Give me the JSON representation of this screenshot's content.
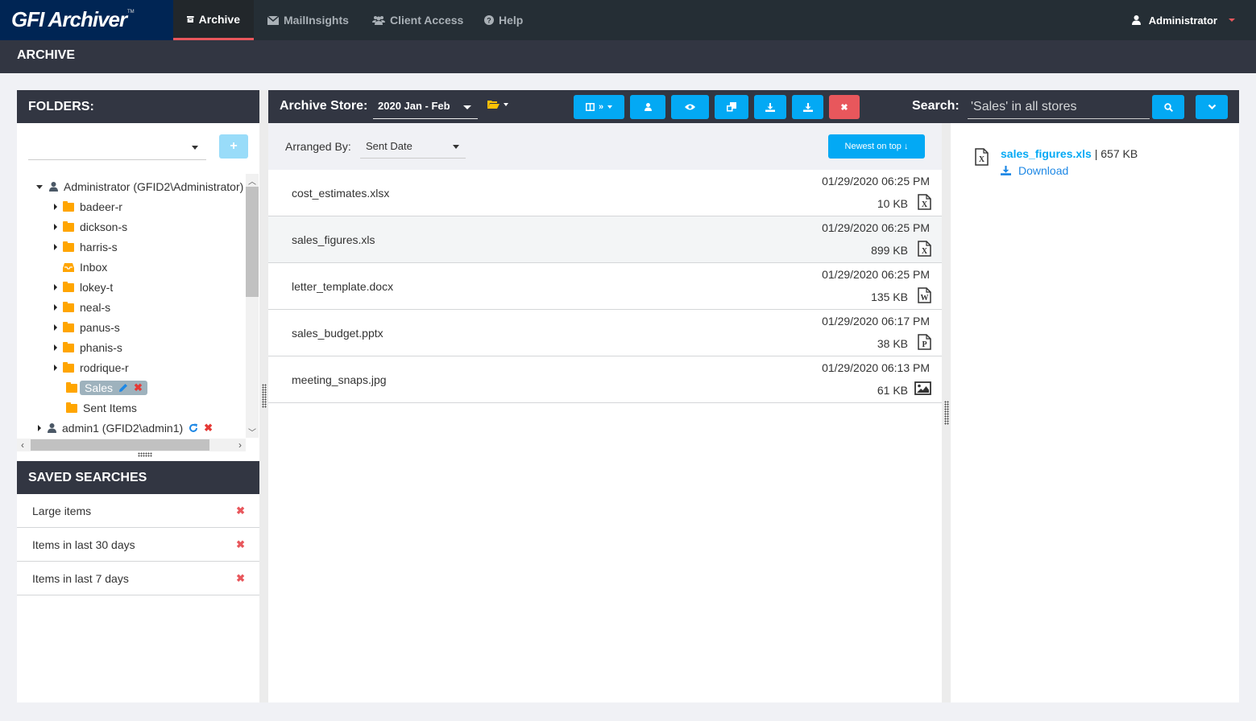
{
  "app": {
    "logo": "GFI Archiver",
    "logo_tm": "TM"
  },
  "nav": {
    "tabs": [
      {
        "label": "Archive",
        "icon": "archive-icon",
        "active": true
      },
      {
        "label": "MailInsights",
        "icon": "envelope-icon",
        "active": false
      },
      {
        "label": "Client Access",
        "icon": "users-icon",
        "active": false
      },
      {
        "label": "Help",
        "icon": "question-circle-icon",
        "active": false
      }
    ],
    "user": "Administrator"
  },
  "subbar": {
    "title": "ARCHIVE"
  },
  "folders": {
    "title": "FOLDERS:",
    "select_value": "",
    "add_label": "+",
    "tree": [
      {
        "label": "Administrator (GFID2\\Administrator)",
        "type": "user",
        "level": 0,
        "expanded": true
      },
      {
        "label": "badeer-r",
        "type": "folder",
        "level": 1,
        "has_children": true
      },
      {
        "label": "dickson-s",
        "type": "folder",
        "level": 1,
        "has_children": true
      },
      {
        "label": "harris-s",
        "type": "folder",
        "level": 1,
        "has_children": true
      },
      {
        "label": "Inbox",
        "type": "inbox",
        "level": 1,
        "has_children": false
      },
      {
        "label": "lokey-t",
        "type": "folder",
        "level": 1,
        "has_children": true
      },
      {
        "label": "neal-s",
        "type": "folder",
        "level": 1,
        "has_children": true
      },
      {
        "label": "panus-s",
        "type": "folder",
        "level": 1,
        "has_children": true
      },
      {
        "label": "phanis-s",
        "type": "folder",
        "level": 1,
        "has_children": true
      },
      {
        "label": "rodrique-r",
        "type": "folder",
        "level": 1,
        "has_children": true
      },
      {
        "label": "Sales",
        "type": "folder",
        "level": 1,
        "has_children": false,
        "selected": true
      },
      {
        "label": "Sent Items",
        "type": "folder",
        "level": 1,
        "has_children": false
      },
      {
        "label": "admin1 (GFID2\\admin1)",
        "type": "user",
        "level": 0,
        "expanded": false
      }
    ]
  },
  "saved_searches": {
    "title": "SAVED SEARCHES",
    "items": [
      {
        "label": "Large items"
      },
      {
        "label": "Items in last 30 days"
      },
      {
        "label": "Items in last 7 days"
      }
    ]
  },
  "toolbar": {
    "store_label": "Archive Store:",
    "store_value": "2020 Jan - Feb",
    "search_label": "Search:",
    "search_placeholder": "'Sales' in all stores",
    "buttons": [
      "columns-icon",
      "user-icon",
      "eye-icon",
      "copy-icon",
      "download-icon",
      "download-icon",
      "close-icon"
    ]
  },
  "arranged": {
    "label": "Arranged By:",
    "value": "Sent Date",
    "sort_label": "Newest on top"
  },
  "items": [
    {
      "name": "cost_estimates.xlsx",
      "date": "01/29/2020 06:25 PM",
      "size": "10 KB",
      "icon": "X"
    },
    {
      "name": "sales_figures.xls",
      "date": "01/29/2020 06:25 PM",
      "size": "899 KB",
      "icon": "X"
    },
    {
      "name": "letter_template.docx",
      "date": "01/29/2020 06:25 PM",
      "size": "135 KB",
      "icon": "W"
    },
    {
      "name": "sales_budget.pptx",
      "date": "01/29/2020 06:17 PM",
      "size": "38 KB",
      "icon": "P"
    },
    {
      "name": "meeting_snaps.jpg",
      "date": "01/29/2020 06:13 PM",
      "size": "61 KB",
      "icon": "image"
    }
  ],
  "preview": {
    "attachment_name": "sales_figures.xls",
    "attachment_size": " | 657 KB",
    "download_label": "Download"
  }
}
